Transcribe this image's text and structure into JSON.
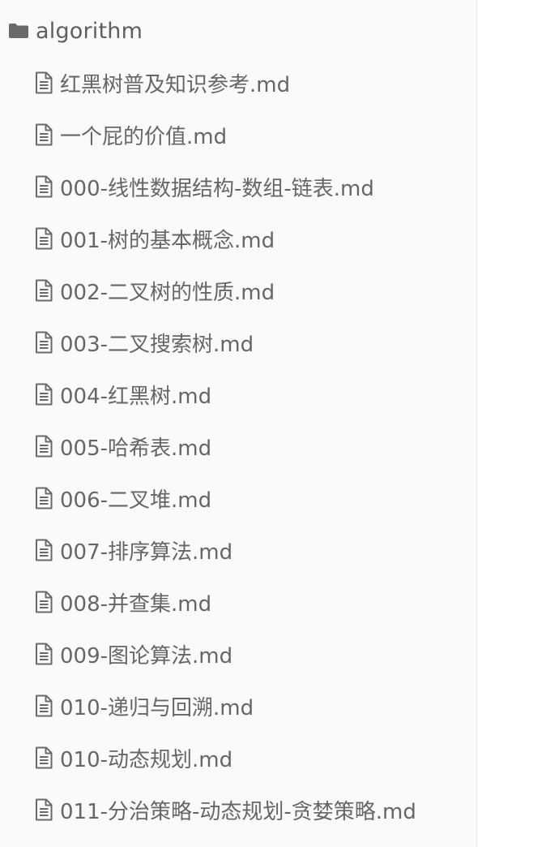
{
  "folder": {
    "name": "algorithm",
    "icon": "folder-icon"
  },
  "files": [
    {
      "name": "红黑树普及知识参考.md"
    },
    {
      "name": "一个屁的价值.md"
    },
    {
      "name": "000-线性数据结构-数组-链表.md"
    },
    {
      "name": "001-树的基本概念.md"
    },
    {
      "name": "002-二叉树的性质.md"
    },
    {
      "name": "003-二叉搜索树.md"
    },
    {
      "name": "004-红黑树.md"
    },
    {
      "name": "005-哈希表.md"
    },
    {
      "name": "006-二叉堆.md"
    },
    {
      "name": "007-排序算法.md"
    },
    {
      "name": "008-并查集.md"
    },
    {
      "name": "009-图论算法.md"
    },
    {
      "name": "010-递归与回溯.md"
    },
    {
      "name": "010-动态规划.md"
    },
    {
      "name": "011-分治策略-动态规划-贪婪策略.md"
    }
  ],
  "colors": {
    "sidebar_bg": "#fafafa",
    "text": "#666666",
    "icon": "#6a6a6a",
    "divider": "#e6e6e6"
  }
}
